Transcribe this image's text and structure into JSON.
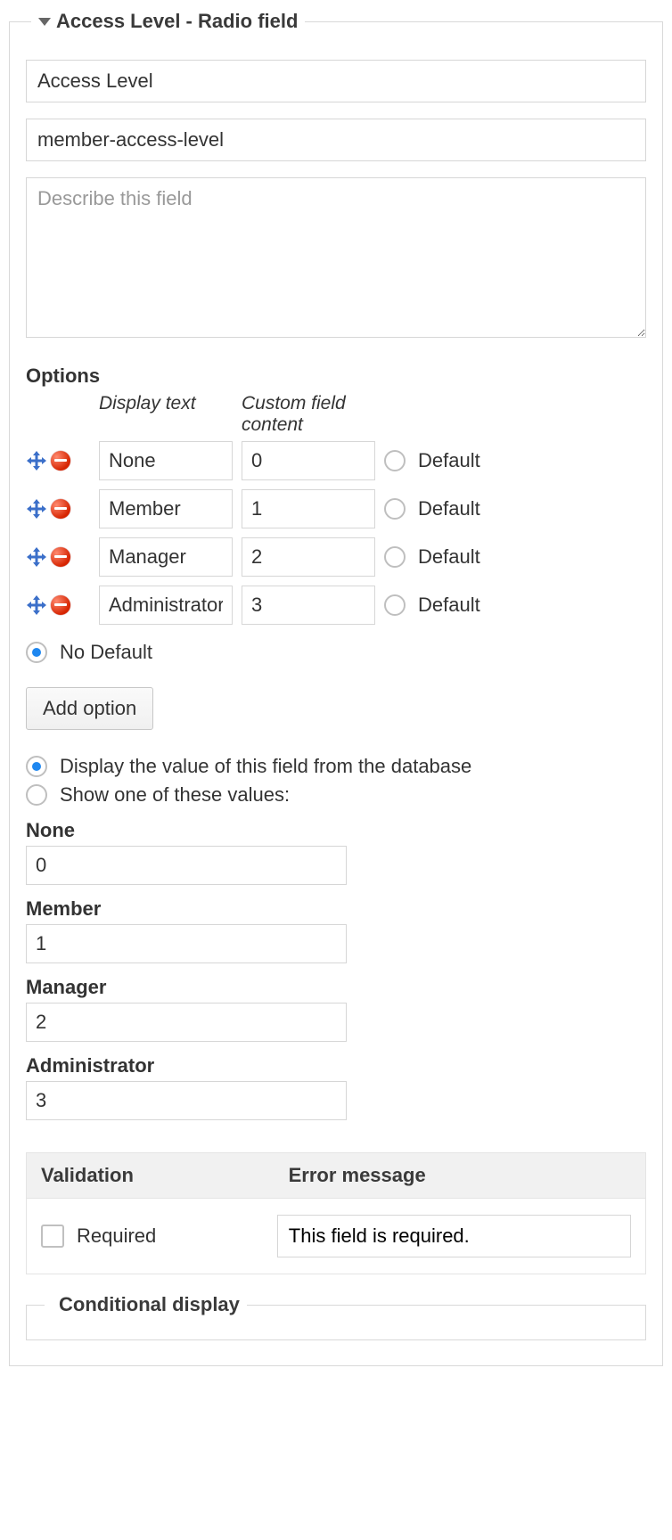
{
  "fieldset": {
    "legend": "Access Level - Radio field",
    "title_value": "Access Level",
    "slug_value": "member-access-level",
    "description_placeholder": "Describe this field"
  },
  "options": {
    "heading": "Options",
    "col_display": "Display text",
    "col_content": "Custom field content",
    "default_label": "Default",
    "rows": [
      {
        "display": "None",
        "content": "0"
      },
      {
        "display": "Member",
        "content": "1"
      },
      {
        "display": "Manager",
        "content": "2"
      },
      {
        "display": "Administrator",
        "content": "3"
      }
    ],
    "no_default_label": "No Default",
    "add_option_label": "Add option"
  },
  "display": {
    "db_label": "Display the value of this field from the database",
    "show_one_label": "Show one of these values:",
    "values": [
      {
        "label": "None",
        "value": "0"
      },
      {
        "label": "Member",
        "value": "1"
      },
      {
        "label": "Manager",
        "value": "2"
      },
      {
        "label": "Administrator",
        "value": "3"
      }
    ]
  },
  "validation": {
    "col_validation": "Validation",
    "col_error": "Error message",
    "required_label": "Required",
    "error_value": "This field is required."
  },
  "conditional": {
    "legend": "Conditional display"
  }
}
